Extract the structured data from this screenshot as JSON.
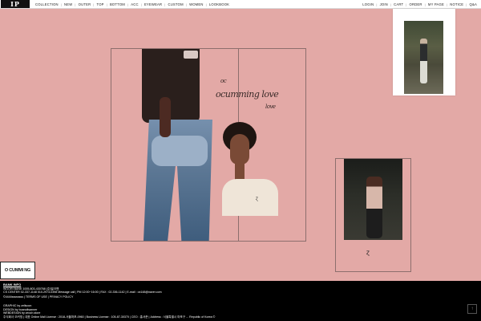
{
  "header": {
    "logo_text": "IP",
    "nav_left": [
      "COLLECTION",
      "NEW",
      "OUTER",
      "TOP",
      "BOTTOM",
      "ACC",
      "EYEWEAR",
      "CUSTOM",
      "WOMEN",
      "LOOKBOOK"
    ],
    "nav_right": [
      "LOGIN",
      "JOIN",
      "CART",
      "ORDER",
      "MY PAGE",
      "NOTICE",
      "Q&A"
    ]
  },
  "lookbook": {
    "script_title": "ocumming love",
    "script_small": "oc",
    "script_small2": "love"
  },
  "badge": {
    "label": "O CUMMI NG LOVE!"
  },
  "footer": {
    "bank_heading": "BANK INFO",
    "bank_line": "WOORI BANK 1005-803-430768 (주)밀크앤",
    "cs_line": "CS CENTER 02-337-1148 010-2973-0398 Message call | PM 12:00~16:00 | FAX : 02-336-1142 | E-mail : ox148@naver.com",
    "copyright": "©4444ssssssss | TERMS OF USE | PRIVACY POLICY",
    "credit_graphic": "GRAPHIC by zellsoon",
    "credit_design": "DESIGN by boanoltsanner",
    "credit_web": "WEBDESIGN by zeoch.store",
    "address_line": "주식회사 오커밍 | 대표 Online Mall License : 2018-서울마포-0960 | Business License : 105-87-30370 | CEO : 홍서준 | Address : 서울특별시 마포구 ... Republic of Korea ©",
    "top_button": "↑"
  }
}
